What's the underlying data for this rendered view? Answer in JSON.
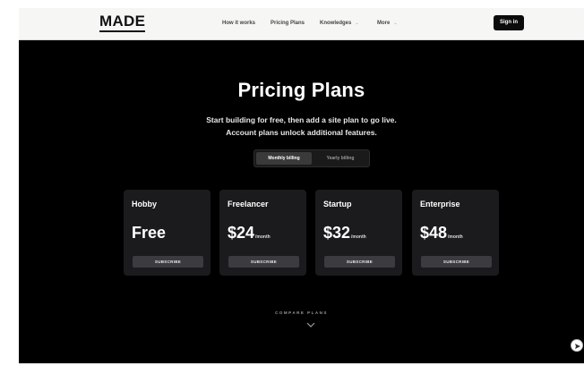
{
  "nav": {
    "logo": "MADE",
    "items": [
      {
        "label": "How it works"
      },
      {
        "label": "Pricing Plans"
      },
      {
        "label": "Knowledges",
        "has_dropdown": true
      },
      {
        "label": "More",
        "has_dropdown": true
      }
    ],
    "signin_label": "Sign in"
  },
  "hero": {
    "title": "Pricing Plans",
    "subtitle_line1": "Start building for free, then add a site plan to go live.",
    "subtitle_line2": "Account plans unlock additional features."
  },
  "billing": {
    "options": [
      "Monthly billing",
      "Yearly billing"
    ],
    "selected": "Monthly billing"
  },
  "plans": [
    {
      "name": "Hobby",
      "price": "Free",
      "unit": "",
      "button": "SUBSCRIBE"
    },
    {
      "name": "Freelancer",
      "price": "$24",
      "unit": "/month",
      "button": "SUBSCRIBE"
    },
    {
      "name": "Startup",
      "price": "$32",
      "unit": "/month",
      "button": "SUBSCRIBE"
    },
    {
      "name": "Enterprise",
      "price": "$48",
      "unit": "/month",
      "button": "SUBSCRIBE"
    }
  ],
  "compare": {
    "label": "COMPARE PLANS",
    "icon": "chevron-down-icon"
  },
  "floating_button": {
    "icon": "send-icon"
  },
  "colors": {
    "page_bg": "#000000",
    "nav_bg": "#f6f6f4",
    "card_bg": "#1b1b1d",
    "button_bg": "#3c3c40",
    "text": "#ffffff"
  }
}
